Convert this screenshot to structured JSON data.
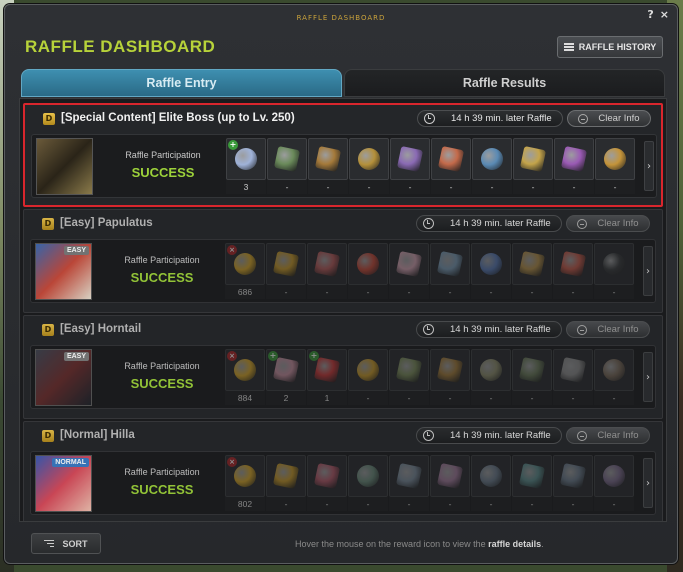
{
  "window": {
    "caption": "RAFFLE DASHBOARD",
    "help_label": "?",
    "close_label": "×",
    "title": "RAFFLE DASHBOARD",
    "history_button": "RAFFLE HISTORY"
  },
  "tabs": [
    {
      "label": "Raffle Entry",
      "active": true
    },
    {
      "label": "Raffle Results",
      "active": false
    }
  ],
  "bosses": [
    {
      "name": "[Special Content] Elite Boss (up to Lv. 250)",
      "timer": "14 h 39 min. later Raffle",
      "clear_label": "Clear Info",
      "participation_label": "Raffle Participation",
      "status": "SUCCESS",
      "badge": "",
      "highlighted": true,
      "rewards": [
        {
          "count": "3",
          "tag": "plus",
          "color": "#9fb2d8"
        },
        {
          "count": "-",
          "tag": "",
          "color": "#6a8a5a"
        },
        {
          "count": "-",
          "tag": "",
          "color": "#a57a3a"
        },
        {
          "count": "-",
          "tag": "",
          "color": "#b4903a"
        },
        {
          "count": "-",
          "tag": "",
          "color": "#8a6ab4"
        },
        {
          "count": "-",
          "tag": "",
          "color": "#c46a4a"
        },
        {
          "count": "-",
          "tag": "",
          "color": "#5a8ab4"
        },
        {
          "count": "-",
          "tag": "",
          "color": "#c4a44a"
        },
        {
          "count": "-",
          "tag": "",
          "color": "#9a5ab4"
        },
        {
          "count": "-",
          "tag": "",
          "color": "#c4943a"
        }
      ]
    },
    {
      "name": "[Easy] Papulatus",
      "timer": "14 h 39 min. later Raffle",
      "clear_label": "Clear Info",
      "participation_label": "Raffle Participation",
      "status": "SUCCESS",
      "badge": "EASY",
      "highlighted": false,
      "rewards": [
        {
          "count": "686",
          "tag": "x",
          "color": "#d8a82a"
        },
        {
          "count": "-",
          "tag": "",
          "color": "#c89a2a"
        },
        {
          "count": "-",
          "tag": "",
          "color": "#b45a5a"
        },
        {
          "count": "-",
          "tag": "",
          "color": "#c44a3a"
        },
        {
          "count": "-",
          "tag": "",
          "color": "#d0a0b0"
        },
        {
          "count": "-",
          "tag": "",
          "color": "#7a9ab4"
        },
        {
          "count": "-",
          "tag": "",
          "color": "#5a7ab4"
        },
        {
          "count": "-",
          "tag": "",
          "color": "#b4904a"
        },
        {
          "count": "-",
          "tag": "",
          "color": "#c45a4a"
        },
        {
          "count": "-",
          "tag": "",
          "color": "#3a3c3e"
        }
      ]
    },
    {
      "name": "[Easy] Horntail",
      "timer": "14 h 39 min. later Raffle",
      "clear_label": "Clear Info",
      "participation_label": "Raffle Participation",
      "status": "SUCCESS",
      "badge": "EASY",
      "highlighted": false,
      "rewards": [
        {
          "count": "884",
          "tag": "x",
          "color": "#d8a82a"
        },
        {
          "count": "2",
          "tag": "plus",
          "color": "#c890a0"
        },
        {
          "count": "1",
          "tag": "plus",
          "color": "#c83a3a"
        },
        {
          "count": "-",
          "tag": "",
          "color": "#c89a2a"
        },
        {
          "count": "-",
          "tag": "",
          "color": "#7a8a5a"
        },
        {
          "count": "-",
          "tag": "",
          "color": "#a07a3a"
        },
        {
          "count": "-",
          "tag": "",
          "color": "#8a8a6a"
        },
        {
          "count": "-",
          "tag": "",
          "color": "#6a7a5a"
        },
        {
          "count": "-",
          "tag": "",
          "color": "#8a8a8a"
        },
        {
          "count": "-",
          "tag": "",
          "color": "#7a6a5a"
        }
      ]
    },
    {
      "name": "[Normal] Hilla",
      "timer": "14 h 39 min. later Raffle",
      "clear_label": "Clear Info",
      "participation_label": "Raffle Participation",
      "status": "SUCCESS",
      "badge": "NORMAL",
      "highlighted": false,
      "rewards": [
        {
          "count": "802",
          "tag": "x",
          "color": "#d8a82a"
        },
        {
          "count": "-",
          "tag": "",
          "color": "#c89a2a"
        },
        {
          "count": "-",
          "tag": "",
          "color": "#b45a6a"
        },
        {
          "count": "-",
          "tag": "",
          "color": "#6a8a7a"
        },
        {
          "count": "-",
          "tag": "",
          "color": "#7a8a9a"
        },
        {
          "count": "-",
          "tag": "",
          "color": "#a07a9a"
        },
        {
          "count": "-",
          "tag": "",
          "color": "#6a7a8a"
        },
        {
          "count": "-",
          "tag": "",
          "color": "#5a8a8a"
        },
        {
          "count": "-",
          "tag": "",
          "color": "#6a7a8a"
        },
        {
          "count": "-",
          "tag": "",
          "color": "#7a6a8a"
        }
      ]
    }
  ],
  "footer": {
    "sort_label": "SORT",
    "hint_prefix": "Hover the mouse on the reward icon to view the",
    "hint_bold": "raffle details",
    "hint_suffix": "."
  },
  "colors": {
    "accent_title": "#b7d23a",
    "status_success": "#9dd23a",
    "highlight_border": "#d9262d",
    "active_tab": "#3e8fb0"
  }
}
